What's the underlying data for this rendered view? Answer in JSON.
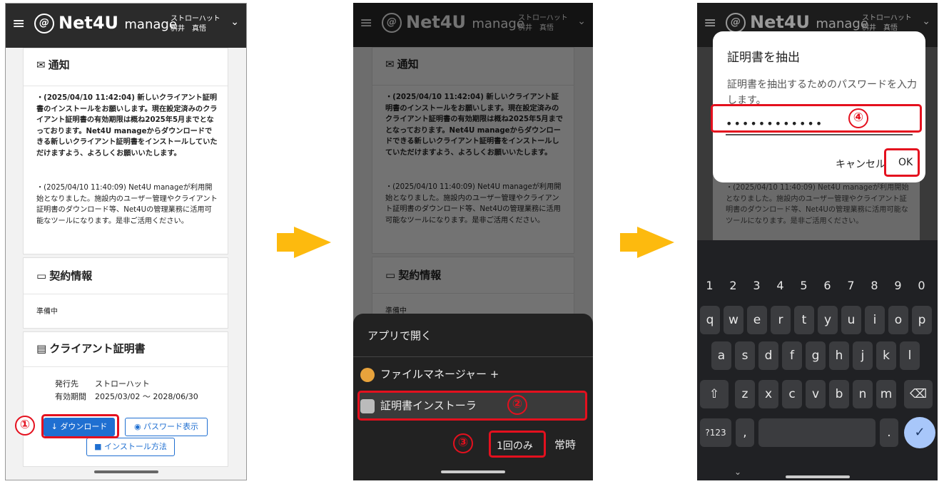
{
  "header": {
    "brand": "Net4U",
    "brand_sub": "manage",
    "user_org": "ストローハット",
    "user_name": "桝井　真悟"
  },
  "notice": {
    "title": "通知",
    "item1": "・(2025/04/10 11:42:04) 新しいクライアント証明書のインストールをお願いします。現在設定済みのクライアント証明書の有効期限は概ね2025年5月までとなっております。Net4U manageからダウンロードできる新しいクライアント証明書をインストールしていただけますよう、よろしくお願いいたします。",
    "item2": "・(2025/04/10 11:40:09) Net4U manageが利用開始となりました。施設内のユーザー管理やクライアント証明書のダウンロード等、Net4Uの管理業務に活用可能なツールになります。是非ご活用ください。"
  },
  "contract": {
    "title": "契約情報",
    "status": "準備中"
  },
  "cert": {
    "title": "クライアント証明書",
    "issuer_label": "発行先",
    "issuer_value": "ストローハット",
    "period_label": "有効期間",
    "period_value": "2025/03/02 〜 2028/06/30",
    "download_btn": "↓ ダウンロード",
    "password_btn": "パスワード表示",
    "install_btn": "インストール方法"
  },
  "sheet": {
    "title": "アプリで開く",
    "app1": "ファイルマネージャー +",
    "app2": "証明書インストーラ",
    "once": "1回のみ",
    "always": "常時"
  },
  "dialog": {
    "title": "証明書を抽出",
    "message": "証明書を抽出するためのパスワードを入力します。",
    "password_mask": "••••••••••••",
    "cancel": "キャンセル",
    "ok": "OK"
  },
  "steps": [
    "①",
    "②",
    "③",
    "④"
  ],
  "keyboard": {
    "numbers": [
      "1",
      "2",
      "3",
      "4",
      "5",
      "6",
      "7",
      "8",
      "9",
      "0"
    ],
    "row1": [
      "q",
      "w",
      "e",
      "r",
      "t",
      "y",
      "u",
      "i",
      "o",
      "p"
    ],
    "row2": [
      "a",
      "s",
      "d",
      "f",
      "g",
      "h",
      "j",
      "k",
      "l"
    ],
    "row3": [
      "z",
      "x",
      "c",
      "v",
      "b",
      "n",
      "m"
    ],
    "symbols_key": "?123",
    "comma": ",",
    "period": "."
  },
  "colors": {
    "arrow": "#FDBA0E",
    "highlight": "#E4101E",
    "header": "#2B2B2B",
    "primary": "#1F6FD1"
  }
}
